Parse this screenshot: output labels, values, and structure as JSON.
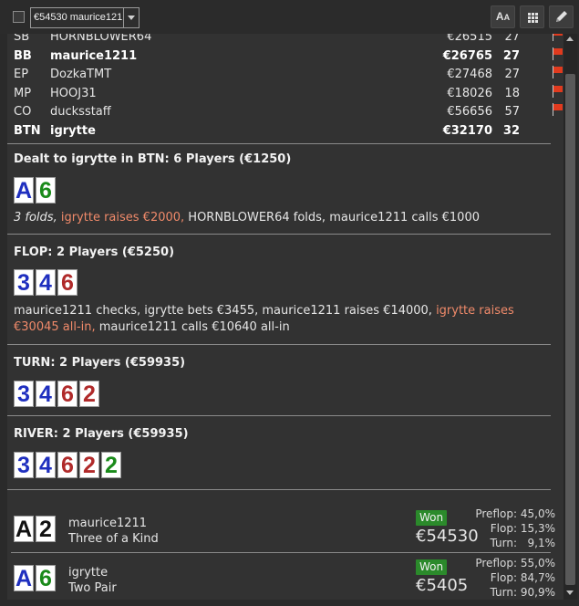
{
  "toolbar": {
    "filter_value": "€54530 maurice1211",
    "font_button_label": "AA",
    "grid_button_icon": "grid-icon",
    "edit_button_icon": "pencil-icon"
  },
  "players": [
    {
      "position": "SB",
      "name": "HORNBLOWER64",
      "stack": "€26515",
      "bb": "27",
      "bold": false,
      "flag": true
    },
    {
      "position": "BB",
      "name": "maurice1211",
      "stack": "€26765",
      "bb": "27",
      "bold": true,
      "flag": true
    },
    {
      "position": "EP",
      "name": "DozkaTMT",
      "stack": "€27468",
      "bb": "27",
      "bold": false,
      "flag": true
    },
    {
      "position": "MP",
      "name": "HOOJ31",
      "stack": "€18026",
      "bb": "18",
      "bold": false,
      "flag": true
    },
    {
      "position": "CO",
      "name": "ducksstaff",
      "stack": "€56656",
      "bb": "57",
      "bold": false,
      "flag": true
    },
    {
      "position": "BTN",
      "name": "igrytte",
      "stack": "€32170",
      "bb": "32",
      "bold": true,
      "flag": false
    }
  ],
  "preflop": {
    "title": "Dealt to igrytte in BTN: 6 Players (€1250)",
    "cards": [
      {
        "rank": "A",
        "suit": "diamond"
      },
      {
        "rank": "6",
        "suit": "club"
      }
    ],
    "actions": [
      {
        "text": "3 folds, ",
        "style": "it"
      },
      {
        "text": "igrytte raises €2000, ",
        "style": "hl"
      },
      {
        "text": "HORNBLOWER64 folds, maurice1211 calls €1000",
        "style": ""
      }
    ]
  },
  "flop": {
    "title": "FLOP: 2 Players (€5250)",
    "cards": [
      {
        "rank": "3",
        "suit": "diamond"
      },
      {
        "rank": "4",
        "suit": "diamond"
      },
      {
        "rank": "6",
        "suit": "heart"
      }
    ],
    "actions": [
      {
        "text": "maurice1211 checks, igrytte bets €3455, maurice1211 raises €14000, ",
        "style": ""
      },
      {
        "text": "igrytte raises €30045 all-in,",
        "style": "hl"
      },
      {
        "text": " maurice1211 calls €10640 all-in",
        "style": ""
      }
    ]
  },
  "turn": {
    "title": "TURN: 2 Players (€59935)",
    "cards": [
      {
        "rank": "3",
        "suit": "diamond"
      },
      {
        "rank": "4",
        "suit": "diamond"
      },
      {
        "rank": "6",
        "suit": "heart"
      },
      {
        "rank": "2",
        "suit": "heart"
      }
    ]
  },
  "river": {
    "title": "RIVER: 2 Players (€59935)",
    "cards": [
      {
        "rank": "3",
        "suit": "diamond"
      },
      {
        "rank": "4",
        "suit": "diamond"
      },
      {
        "rank": "6",
        "suit": "heart"
      },
      {
        "rank": "2",
        "suit": "heart"
      },
      {
        "rank": "2",
        "suit": "club"
      }
    ]
  },
  "results": [
    {
      "name": "maurice1211",
      "hand": "Three of a Kind",
      "cards": [
        {
          "rank": "A",
          "suit": "spade"
        },
        {
          "rank": "2",
          "suit": "spade"
        }
      ],
      "badge": "Won",
      "amount": "€54530",
      "equity": [
        {
          "label": "Preflop:",
          "value": "45,0%"
        },
        {
          "label": "Flop:",
          "value": "15,3%"
        },
        {
          "label": "Turn:",
          "value": "9,1%"
        }
      ]
    },
    {
      "name": "igrytte",
      "hand": "Two Pair",
      "cards": [
        {
          "rank": "A",
          "suit": "diamond"
        },
        {
          "rank": "6",
          "suit": "club"
        }
      ],
      "badge": "Won",
      "amount": "€5405",
      "equity": [
        {
          "label": "Preflop:",
          "value": "55,0%"
        },
        {
          "label": "Flop:",
          "value": "84,7%"
        },
        {
          "label": "Turn:",
          "value": "90,9%"
        }
      ]
    }
  ]
}
